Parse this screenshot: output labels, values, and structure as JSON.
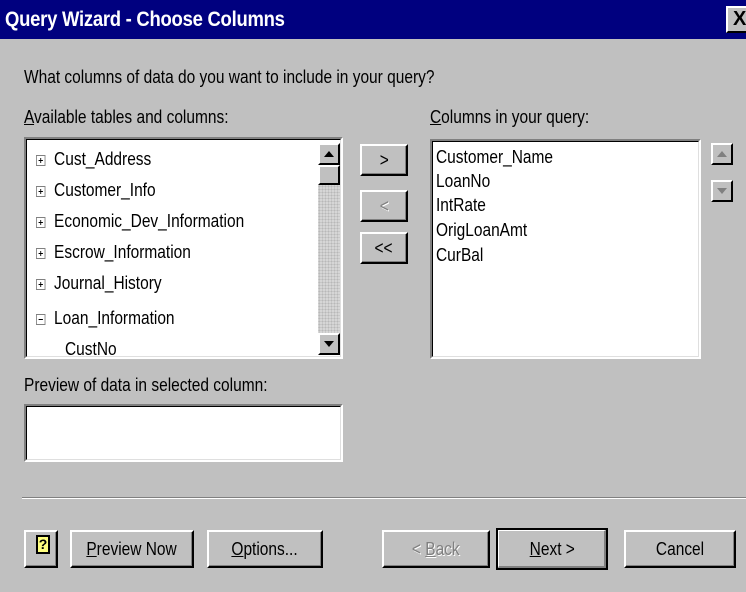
{
  "window": {
    "title": "Query Wizard - Choose Columns",
    "close_glyph": "X"
  },
  "prompt": "What columns of data do you want to include in your query?",
  "available": {
    "label_underlined": "A",
    "label_rest": "vailable tables and columns:",
    "items": [
      {
        "label": "Cust_Address",
        "expander": "plus"
      },
      {
        "label": "Customer_Info",
        "expander": "plus"
      },
      {
        "label": "Economic_Dev_Information",
        "expander": "plus"
      },
      {
        "label": "Escrow_Information",
        "expander": "plus"
      },
      {
        "label": "Journal_History",
        "expander": "plus"
      },
      {
        "label": "Loan_Information",
        "expander": "minus"
      },
      {
        "label": "CustNo",
        "expander": "none"
      }
    ]
  },
  "move_buttons": {
    "add": ">",
    "remove": "<",
    "remove_all": "<<"
  },
  "query_columns": {
    "label_underlined": "C",
    "label_rest": "olumns in your query:",
    "items": [
      "Customer_Name",
      "LoanNo",
      "IntRate",
      "OrigLoanAmt",
      "CurBal"
    ]
  },
  "preview": {
    "label": "Preview of data in selected column:",
    "value": ""
  },
  "footer": {
    "help_glyph": "?",
    "preview_now_u": "P",
    "preview_now_rest": "review Now",
    "options_u": "O",
    "options_rest": "ptions...",
    "back_pre": "< ",
    "back_u": "B",
    "back_rest": "ack",
    "next_u": "N",
    "next_rest": "ext >",
    "cancel": "Cancel"
  },
  "colors": {
    "titlebar": "#00007f",
    "dialog_face": "#c0c0c0",
    "list_background": "#ffffff"
  }
}
